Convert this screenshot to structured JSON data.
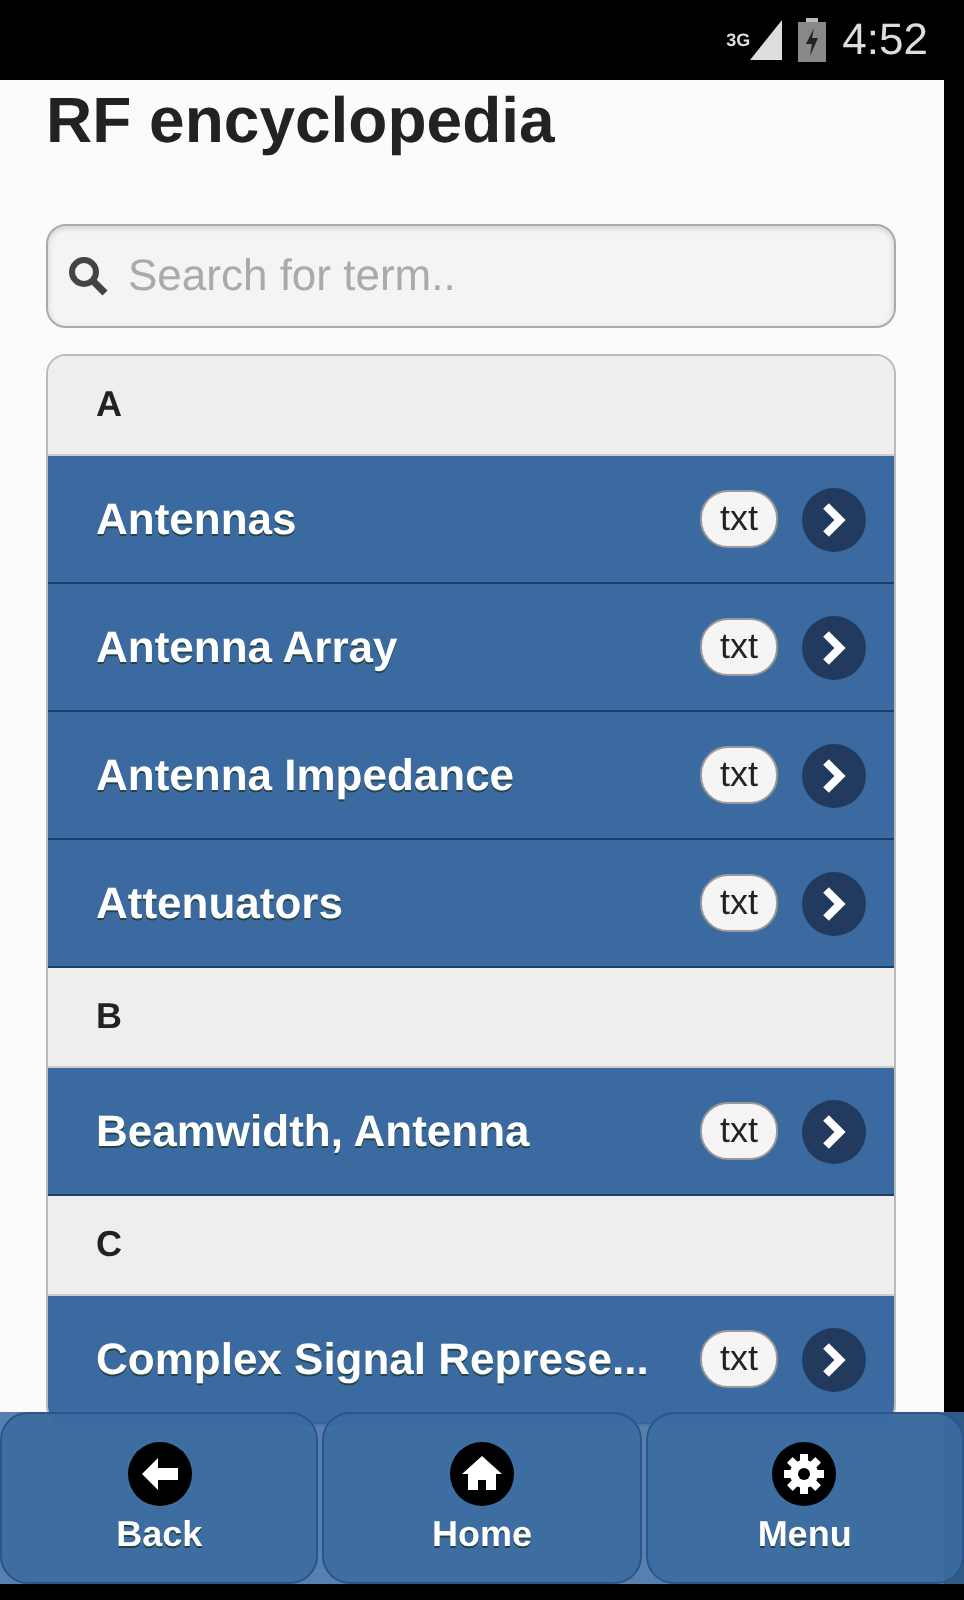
{
  "status_bar": {
    "network": "3G",
    "time": "4:52"
  },
  "title": "RF encyclopedia",
  "search": {
    "placeholder": "Search for term.."
  },
  "list": [
    {
      "kind": "divider",
      "label": "A"
    },
    {
      "kind": "item",
      "label": "Antennas",
      "badge": "txt"
    },
    {
      "kind": "item",
      "label": "Antenna Array",
      "badge": "txt"
    },
    {
      "kind": "item",
      "label": "Antenna Impedance",
      "badge": "txt"
    },
    {
      "kind": "item",
      "label": "Attenuators",
      "badge": "txt"
    },
    {
      "kind": "divider",
      "label": "B"
    },
    {
      "kind": "item",
      "label": "Beamwidth, Antenna",
      "badge": "txt"
    },
    {
      "kind": "divider",
      "label": "C"
    },
    {
      "kind": "item",
      "label": "Complex Signal Represe...",
      "badge": "txt"
    }
  ],
  "footer": [
    {
      "label": "Back"
    },
    {
      "label": "Home"
    },
    {
      "label": "Menu"
    }
  ]
}
